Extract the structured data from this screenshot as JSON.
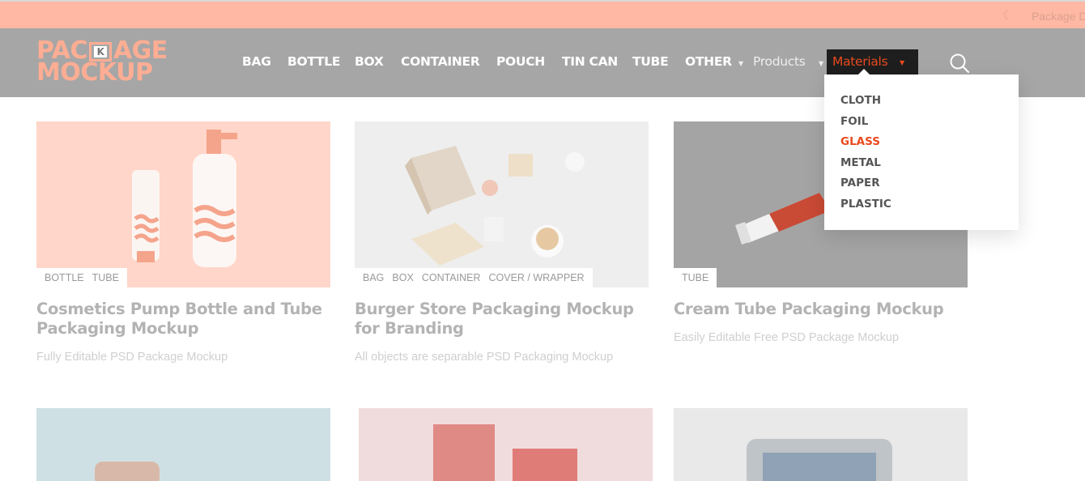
{
  "topbar": {
    "theme_icon": "moon-icon",
    "site_label_partial": "Package D"
  },
  "logo": {
    "line1_a": "PAC",
    "line1_k": "K",
    "line1_b": "AGE",
    "line2": "MOCKUP"
  },
  "nav": {
    "items": [
      "BAG",
      "BOTTLE",
      "BOX",
      "CONTAINER",
      "POUCH",
      "TIN CAN",
      "TUBE",
      "OTHER"
    ],
    "products": "Products",
    "materials": "Materials",
    "search_icon": "search-icon"
  },
  "materials_menu": [
    "CLOTH",
    "FOIL",
    "GLASS",
    "METAL",
    "PAPER",
    "PLASTIC"
  ],
  "materials_active": "GLASS",
  "cards": [
    {
      "tags": [
        "BOTTLE",
        "TUBE"
      ],
      "title": "Cosmetics Pump Bottle and Tube Packaging Mockup",
      "desc": "Fully Editable PSD Package Mockup"
    },
    {
      "tags": [
        "BAG",
        "BOX",
        "CONTAINER",
        "COVER / WRAPPER"
      ],
      "title": "Burger Store Packaging Mockup for Branding",
      "desc": "All objects are separable PSD Packaging Mockup"
    },
    {
      "tags": [
        "TUBE"
      ],
      "title": "Cream Tube Packaging Mockup",
      "desc": "Easily Editable Free PSD Package Mockup"
    }
  ],
  "colors": {
    "accent": "#e84a1e",
    "brand": "#ffad93",
    "topbar": "#ffb8a3",
    "header": "#a6a6a6"
  }
}
